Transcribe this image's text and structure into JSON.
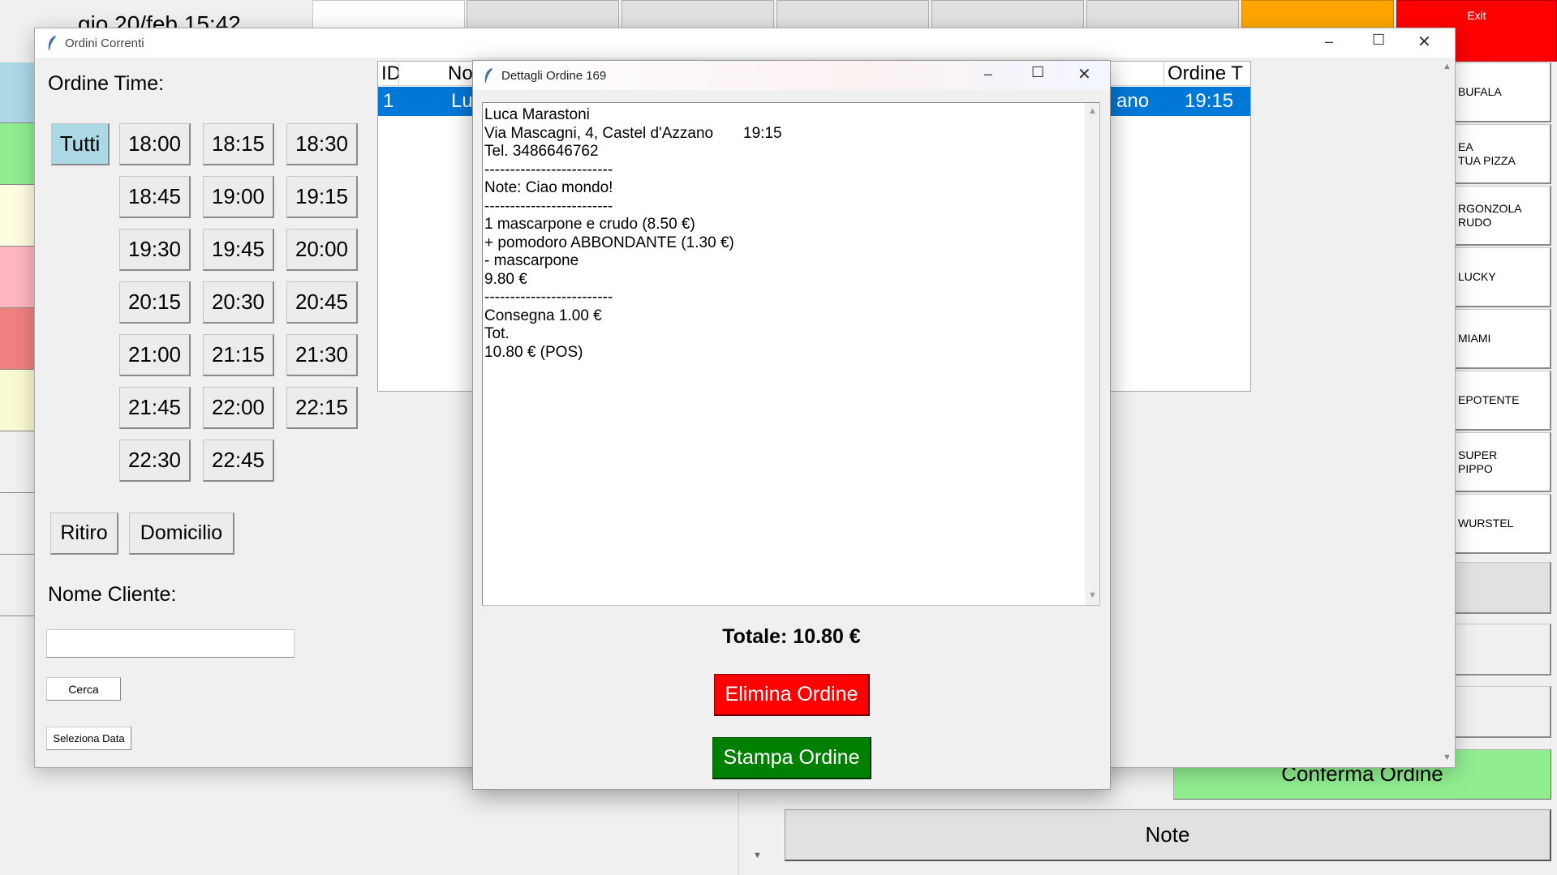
{
  "main": {
    "datetime": "gio 20/feb 15:42",
    "exit_label": "Exit",
    "side_items": [
      "BUFALA",
      "EA\nTUA PIZZA",
      "RGONZOLA\nRUDO",
      "LUCKY",
      "MIAMI",
      "EPOTENTE",
      "SUPER\nPIPPO",
      "WURSTEL"
    ],
    "confirm_label": "Conferma Ordine",
    "note_label": "Note"
  },
  "orders_window": {
    "title": "Ordini Correnti",
    "time_label": "Ordine Time:",
    "time_buttons": [
      "Tutti",
      "18:00",
      "18:15",
      "18:30",
      "18:45",
      "19:00",
      "19:15",
      "19:30",
      "19:45",
      "20:00",
      "20:15",
      "20:30",
      "20:45",
      "21:00",
      "21:15",
      "21:30",
      "21:45",
      "22:00",
      "22:15",
      "22:30",
      "22:45"
    ],
    "ritiro_label": "Ritiro",
    "domicilio_label": "Domicilio",
    "nome_cliente_label": "Nome Cliente:",
    "nome_cliente_value": "",
    "cerca_label": "Cerca",
    "seleziona_data_label": "Seleziona Data",
    "table": {
      "col_id": "ID",
      "col_nome": "No",
      "col_ordine_time": "Ordine T",
      "row": {
        "id": "1",
        "nome": "Lu",
        "address_tail": "ano",
        "time": "19:15"
      }
    }
  },
  "details_window": {
    "title": "Dettagli Ordine 169",
    "lines": [
      "Luca Marastoni",
      "Via Mascagni, 4, Castel d'Azzano       19:15",
      "Tel. 3486646762",
      "-------------------------",
      "Note: Ciao mondo!",
      "-------------------------",
      "1 mascarpone e crudo (8.50 €)",
      "+ pomodoro ABBONDANTE (1.30 €)",
      "- mascarpone",
      "9.80 €",
      "-------------------------",
      "Consegna 1.00 €",
      "Tot.",
      "10.80 € (POS)"
    ],
    "total_label": "Totale: 10.80 €",
    "delete_label": "Elimina Ordine",
    "print_label": "Stampa Ordine"
  },
  "colors": {
    "exit_red": "#ff0000",
    "orange_tab": "#ffa500",
    "confirm_green": "#90ee90",
    "delete_red": "#ff0000",
    "print_green": "#008000",
    "selection_blue": "#0078d7",
    "tutti_blue": "#add8e6"
  }
}
